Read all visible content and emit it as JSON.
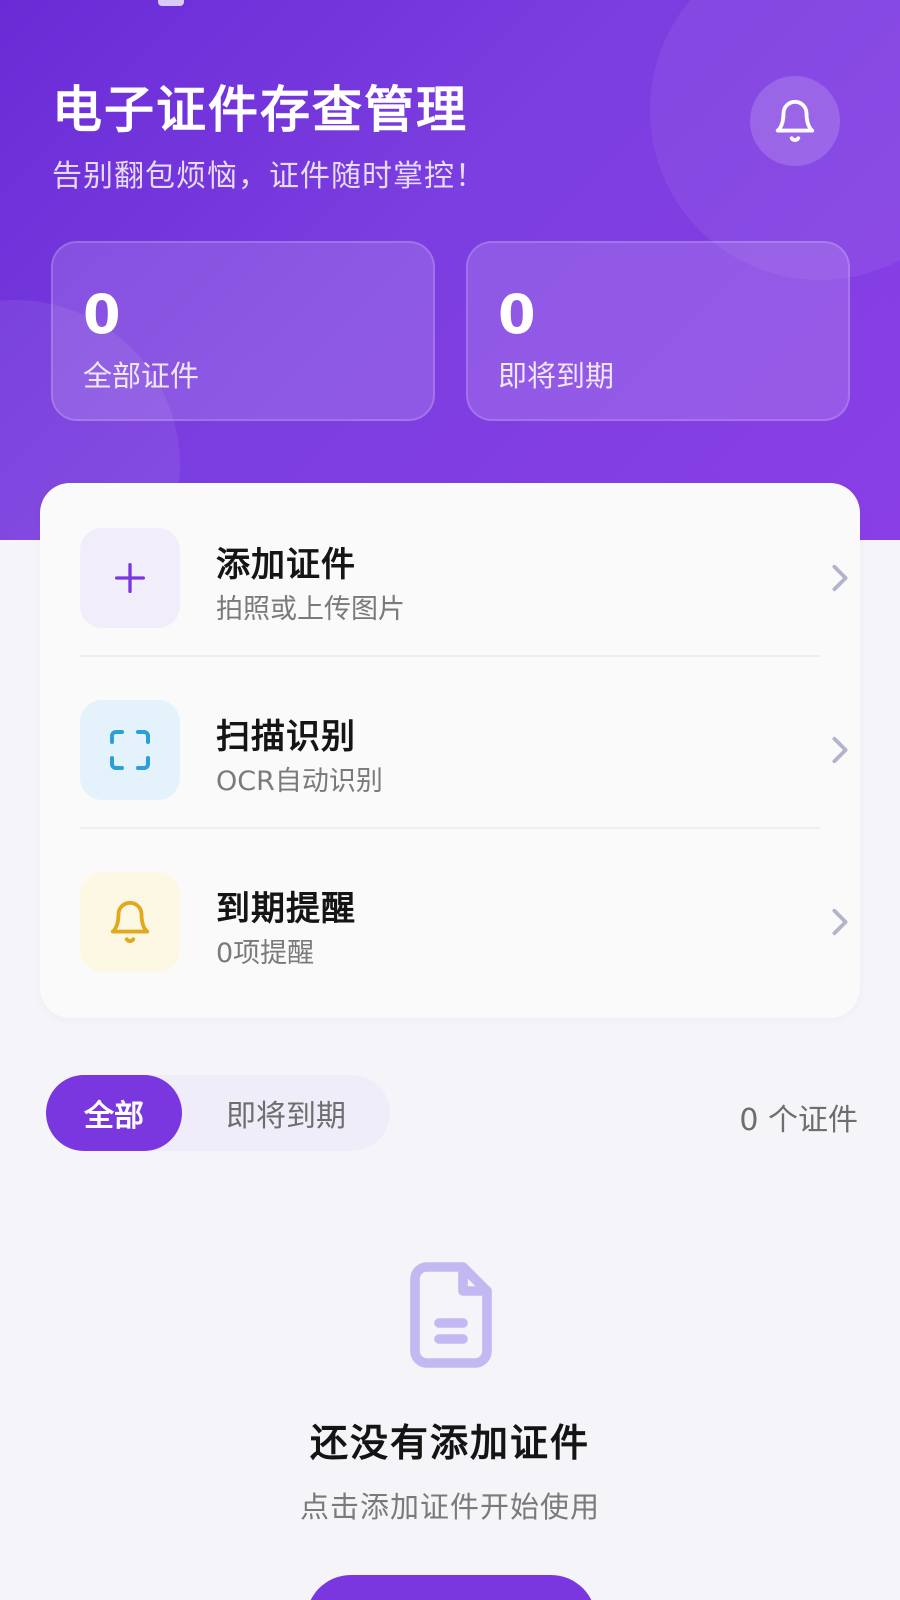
{
  "header": {
    "title": "电子证件存查管理",
    "subtitle": "告别翻包烦恼，证件随时掌控！",
    "bell_icon": "bell-icon"
  },
  "stats": [
    {
      "value": "0",
      "label": "全部证件"
    },
    {
      "value": "0",
      "label": "即将到期"
    }
  ],
  "actions": [
    {
      "title": "添加证件",
      "subtitle": "拍照或上传图片",
      "icon": "plus-icon",
      "color": "#7a37e0"
    },
    {
      "title": "扫描识别",
      "subtitle": "OCR自动识别",
      "icon": "scan-icon",
      "color": "#2a9fd8"
    },
    {
      "title": "到期提醒",
      "subtitle": "0项提醒",
      "icon": "bell-icon",
      "color": "#e2a81e"
    }
  ],
  "filter": {
    "tabs": [
      "全部",
      "即将到期"
    ],
    "active": "全部",
    "count_text": "0 个证件"
  },
  "empty_state": {
    "icon": "document-icon",
    "title": "还没有添加证件",
    "subtitle": "点击添加证件开始使用"
  },
  "colors": {
    "accent": "#7a37e0",
    "header_gradient_start": "#6a2bd6",
    "header_gradient_end": "#8a3fe6"
  }
}
